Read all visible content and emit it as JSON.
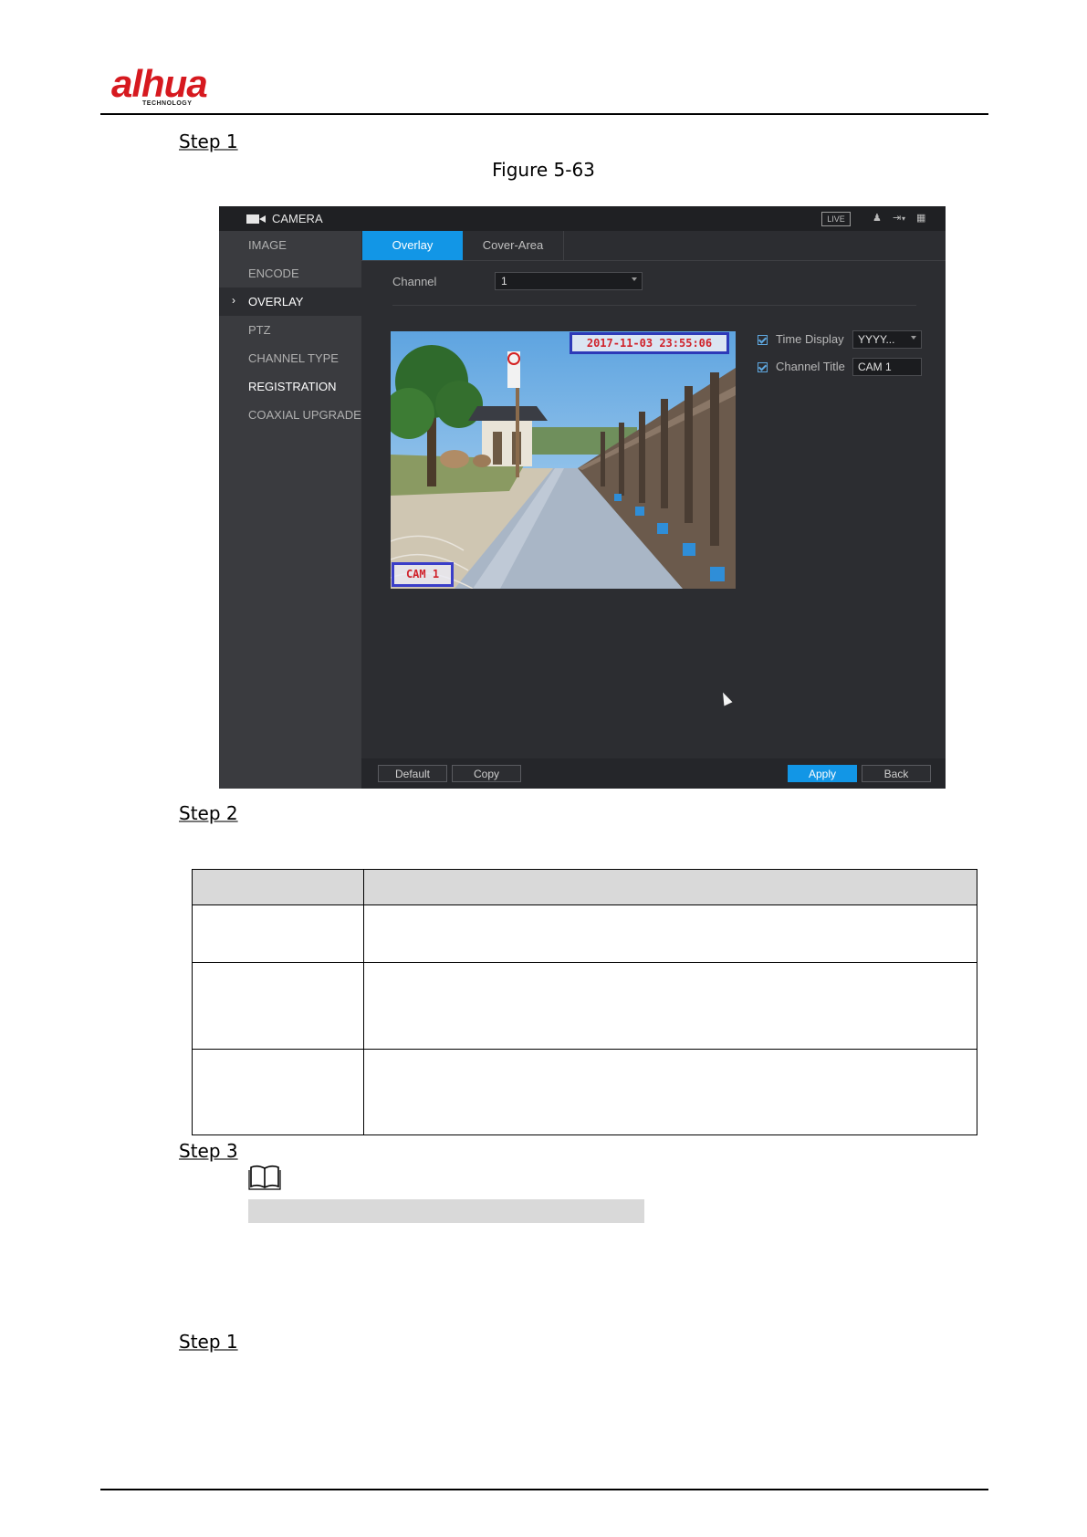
{
  "header": {
    "logo_text": "alhua",
    "logo_sub": "TECHNOLOGY"
  },
  "steps": {
    "step1_top": "Step 1",
    "step2": "Step 2",
    "step3": "Step 3",
    "step1_bottom": "Step 1"
  },
  "figure_caption": "Figure 5-63",
  "app": {
    "window_title": "CAMERA",
    "live_badge": "LIVE",
    "sidebar": {
      "items": [
        {
          "label": "IMAGE"
        },
        {
          "label": "ENCODE"
        },
        {
          "label": "OVERLAY"
        },
        {
          "label": "PTZ"
        },
        {
          "label": "CHANNEL TYPE"
        },
        {
          "label": "REGISTRATION"
        },
        {
          "label": "COAXIAL UPGRADE"
        }
      ],
      "selected_marker": "›"
    },
    "tabs": [
      {
        "label": "Overlay"
      },
      {
        "label": "Cover-Area"
      }
    ],
    "channel": {
      "label": "Channel",
      "value": "1"
    },
    "preview": {
      "time_overlay": "2017-11-03 23:55:06",
      "title_overlay": "CAM 1"
    },
    "options": {
      "time_display_label": "Time Display",
      "time_display_value": "YYYY...",
      "channel_title_label": "Channel Title",
      "channel_title_value": "CAM 1"
    },
    "buttons": {
      "default": "Default",
      "copy": "Copy",
      "apply": "Apply",
      "back": "Back"
    },
    "colors": {
      "accent": "#1296e6",
      "overlay_text": "#d0222b",
      "overlay_border": "#2d3ab8"
    }
  }
}
